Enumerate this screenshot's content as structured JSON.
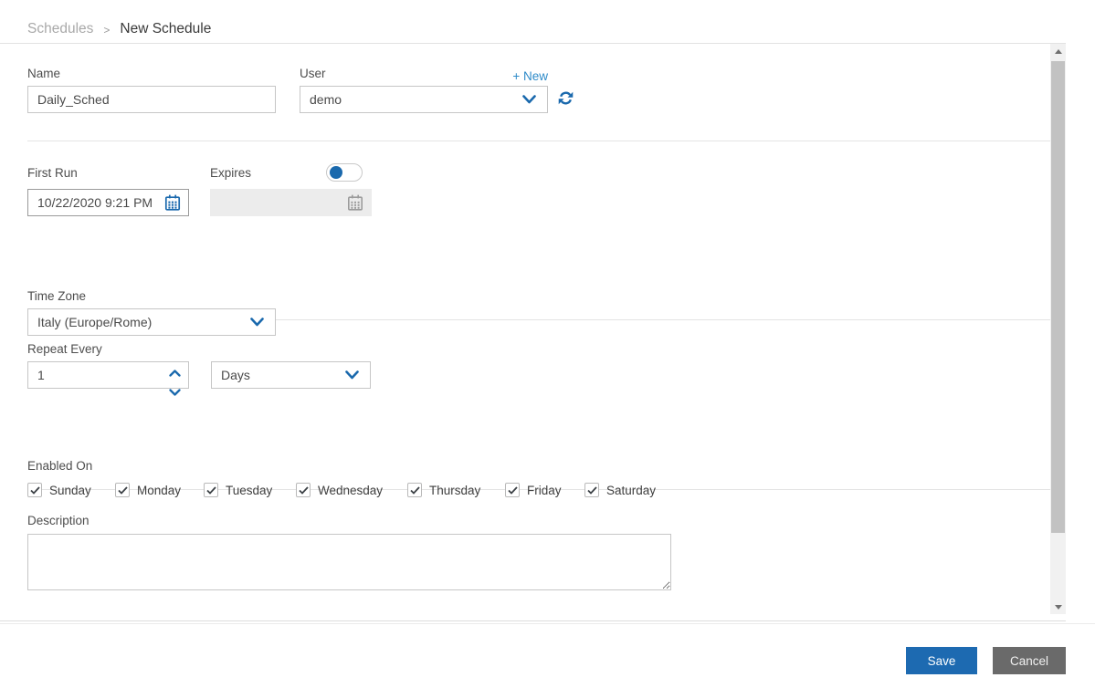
{
  "breadcrumb": {
    "parent": "Schedules",
    "separator": ">",
    "current": "New Schedule"
  },
  "form": {
    "name": {
      "label": "Name",
      "value": "Daily_Sched"
    },
    "user": {
      "label": "User",
      "value": "demo",
      "new_link": "+ New"
    },
    "first_run": {
      "label": "First Run",
      "value": "10/22/2020 9:21 PM"
    },
    "expires": {
      "label": "Expires",
      "enabled": false,
      "value": ""
    },
    "time_zone": {
      "label": "Time Zone",
      "value": "Italy (Europe/Rome)"
    },
    "repeat_every": {
      "label": "Repeat Every",
      "value": "1",
      "unit": "Days"
    },
    "enabled_on": {
      "label": "Enabled On",
      "days": [
        {
          "label": "Sunday",
          "checked": true
        },
        {
          "label": "Monday",
          "checked": true
        },
        {
          "label": "Tuesday",
          "checked": true
        },
        {
          "label": "Wednesday",
          "checked": true
        },
        {
          "label": "Thursday",
          "checked": true
        },
        {
          "label": "Friday",
          "checked": true
        },
        {
          "label": "Saturday",
          "checked": true
        }
      ]
    },
    "description": {
      "label": "Description",
      "value": ""
    }
  },
  "footer": {
    "save_label": "Save",
    "cancel_label": "Cancel"
  },
  "colors": {
    "accent_blue": "#1a69ad",
    "link_blue": "#2e8bc9",
    "save_button": "#1d6ab1",
    "cancel_button": "#6a6a6a"
  }
}
